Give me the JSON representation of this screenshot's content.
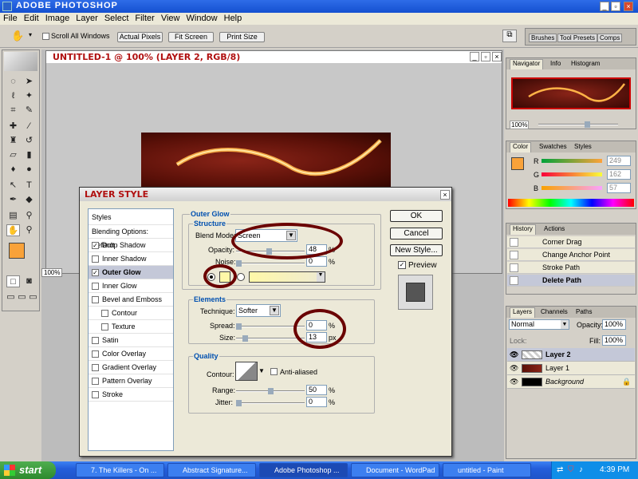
{
  "app": {
    "title": "ADOBE PHOTOSHOP"
  },
  "menu": [
    "File",
    "Edit",
    "Image",
    "Layer",
    "Select",
    "Filter",
    "View",
    "Window",
    "Help"
  ],
  "options": {
    "scroll_all": "Scroll All Windows",
    "actual_pixels": "Actual Pixels",
    "fit_screen": "Fit Screen",
    "print_size": "Print Size",
    "well_tabs": [
      "Brushes",
      "Tool Presets",
      "Comps"
    ]
  },
  "document": {
    "title": "UNTITLED-1 @ 100% (LAYER 2, RGB/8)",
    "zoom": "100%"
  },
  "dialog": {
    "title": "LAYER STYLE",
    "styles_header": "Styles",
    "style_items": [
      {
        "label": "Blending Options: Default",
        "checkbox": false,
        "checked": false,
        "indent": 0
      },
      {
        "label": "Drop Shadow",
        "checkbox": true,
        "checked": true,
        "indent": 0
      },
      {
        "label": "Inner Shadow",
        "checkbox": true,
        "checked": false,
        "indent": 0
      },
      {
        "label": "Outer Glow",
        "checkbox": true,
        "checked": true,
        "indent": 0,
        "selected": true
      },
      {
        "label": "Inner Glow",
        "checkbox": true,
        "checked": false,
        "indent": 0
      },
      {
        "label": "Bevel and Emboss",
        "checkbox": true,
        "checked": false,
        "indent": 0
      },
      {
        "label": "Contour",
        "checkbox": true,
        "checked": false,
        "indent": 1
      },
      {
        "label": "Texture",
        "checkbox": true,
        "checked": false,
        "indent": 1
      },
      {
        "label": "Satin",
        "checkbox": true,
        "checked": false,
        "indent": 0
      },
      {
        "label": "Color Overlay",
        "checkbox": true,
        "checked": false,
        "indent": 0
      },
      {
        "label": "Gradient Overlay",
        "checkbox": true,
        "checked": false,
        "indent": 0
      },
      {
        "label": "Pattern Overlay",
        "checkbox": true,
        "checked": false,
        "indent": 0
      },
      {
        "label": "Stroke",
        "checkbox": true,
        "checked": false,
        "indent": 0
      }
    ],
    "section_title": "Outer Glow",
    "structure": {
      "title": "Structure",
      "blend_mode_label": "Blend Mode:",
      "blend_mode": "Screen",
      "opacity_label": "Opacity:",
      "opacity": "48",
      "opacity_fraction": 0.48,
      "noise_label": "Noise:",
      "noise": "0",
      "noise_fraction": 0.0,
      "glow_color": "#fff8a8",
      "unit": "%"
    },
    "elements": {
      "title": "Elements",
      "technique_label": "Technique:",
      "technique": "Softer",
      "spread_label": "Spread:",
      "spread": "0",
      "spread_unit": "%",
      "size_label": "Size:",
      "size": "13",
      "size_unit": "px"
    },
    "quality": {
      "title": "Quality",
      "contour_label": "Contour:",
      "anti_aliased": "Anti-aliased",
      "range_label": "Range:",
      "range": "50",
      "range_fraction": 0.5,
      "jitter_label": "Jitter:",
      "jitter": "0",
      "unit": "%"
    },
    "buttons": {
      "ok": "OK",
      "cancel": "Cancel",
      "new_style": "New Style...",
      "preview": "Preview"
    }
  },
  "navigator": {
    "tabs": [
      "Navigator",
      "Info",
      "Histogram"
    ],
    "zoom": "100%"
  },
  "color_panel": {
    "tabs": [
      "Color",
      "Swatches",
      "Styles"
    ],
    "r_label": "R",
    "g_label": "G",
    "b_label": "B",
    "r": "249",
    "g": "162",
    "b": "57",
    "foreground": "#f9a239"
  },
  "history": {
    "tabs": [
      "History",
      "Actions"
    ],
    "items": [
      "Corner Drag",
      "Change Anchor Point",
      "Stroke Path",
      "Delete Path"
    ]
  },
  "layers": {
    "tabs": [
      "Layers",
      "Channels",
      "Paths"
    ],
    "blend": "Normal",
    "opacity_label": "Opacity:",
    "opacity": "100%",
    "lock_label": "Lock:",
    "fill_label": "Fill:",
    "fill": "100%",
    "items": [
      "Layer 2",
      "Layer 1",
      "Background"
    ]
  },
  "taskbar": {
    "start": "start",
    "items": [
      "7. The Killers - On ...",
      "Abstract Signature...",
      "Adobe Photoshop ...",
      "Document - WordPad",
      "untitled - Paint"
    ],
    "clock": "4:39 PM"
  }
}
